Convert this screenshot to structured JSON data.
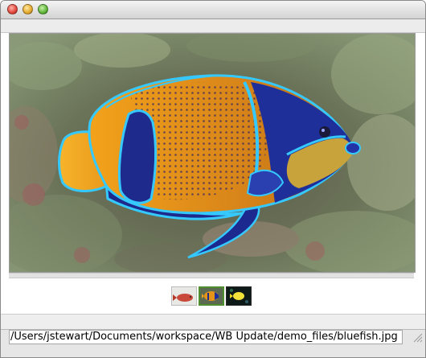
{
  "window": {
    "controls": [
      {
        "name": "close",
        "color": "#e0463b"
      },
      {
        "name": "minimize",
        "color": "#e5a92a"
      },
      {
        "name": "zoom",
        "color": "#5fb53a"
      }
    ]
  },
  "image_view": {
    "subject": "fish-image",
    "background_color": "#5d6a52",
    "fish_colors": {
      "body": "#e69418",
      "blue": "#1f2f9a",
      "outline": "#35c9ff"
    }
  },
  "thumbnails": [
    {
      "name": "thumbnail-red-fish",
      "selected": false
    },
    {
      "name": "thumbnail-bluefish",
      "selected": true
    },
    {
      "name": "thumbnail-yellow-fish",
      "selected": false
    }
  ],
  "status": {
    "path": "/Users/jstewart/Documents/workspace/WB Update/demo_files/bluefish.jpg"
  }
}
